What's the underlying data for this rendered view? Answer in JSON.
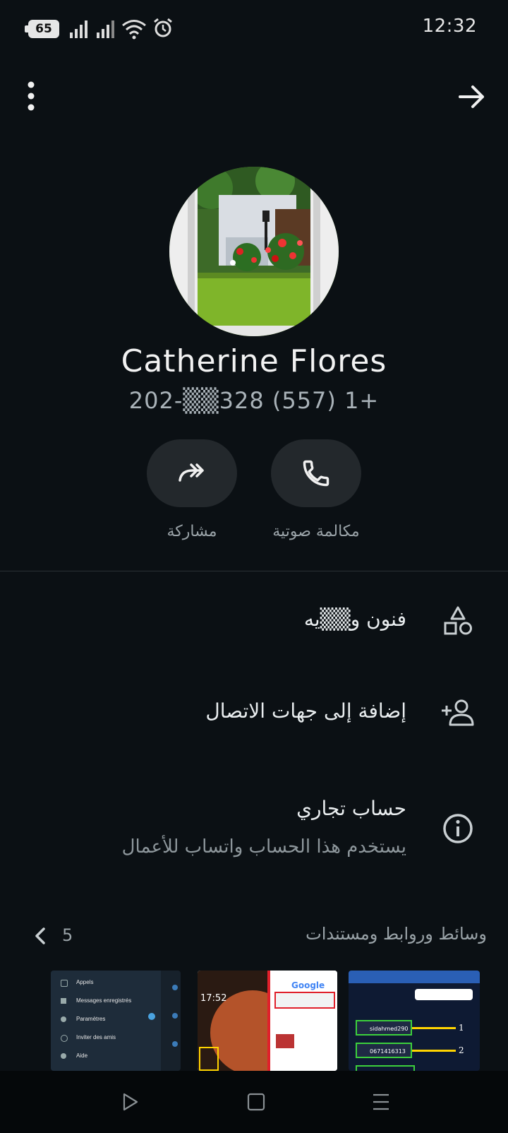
{
  "status_bar": {
    "battery_level": "65",
    "time": "12:32",
    "icons": [
      "signal-icon",
      "signal-icon",
      "wifi-icon",
      "alarm-icon"
    ]
  },
  "top_bar": {
    "menu_icon": "more-vertical-icon",
    "back_icon": "arrow-right-icon"
  },
  "contact": {
    "name": "Catherine Flores",
    "phone": "202-▒▒328 (557) 1+"
  },
  "actions": [
    {
      "label": "مكالمة صوتية",
      "icon": "phone-icon"
    },
    {
      "label": "مشاركة",
      "icon": "share-icon"
    }
  ],
  "list": [
    {
      "title": "فنون و▒▒يه",
      "icon": "shapes-icon"
    },
    {
      "title": "إضافة إلى جهات الاتصال",
      "icon": "add-contact-icon"
    },
    {
      "title": "حساب تجاري",
      "subtitle": "يستخدم هذا الحساب واتساب للأعمال",
      "icon": "info-icon"
    }
  ],
  "media": {
    "title": "وسائط وروابط ومستندات",
    "count": "5",
    "thumbnails": [
      {
        "name": "telegram-menu-screenshot",
        "items": [
          "Appels",
          "Messages enregistrés",
          "Paramètres",
          "Inviter des amis",
          "Aide"
        ]
      },
      {
        "name": "browser-home-screenshot",
        "clock": "17:52",
        "google_label": "Google"
      },
      {
        "name": "login-screenshot",
        "fields": [
          "sidahmed290",
          "0671416313"
        ],
        "markers": [
          "1",
          "2"
        ]
      }
    ]
  },
  "nav_bar": {
    "icons": [
      "recent-apps-icon",
      "home-icon",
      "back-icon"
    ]
  },
  "colors": {
    "background": "#0b1014",
    "button_bg": "#23282c",
    "text_primary": "#e9edef",
    "text_secondary": "#8d969b"
  }
}
